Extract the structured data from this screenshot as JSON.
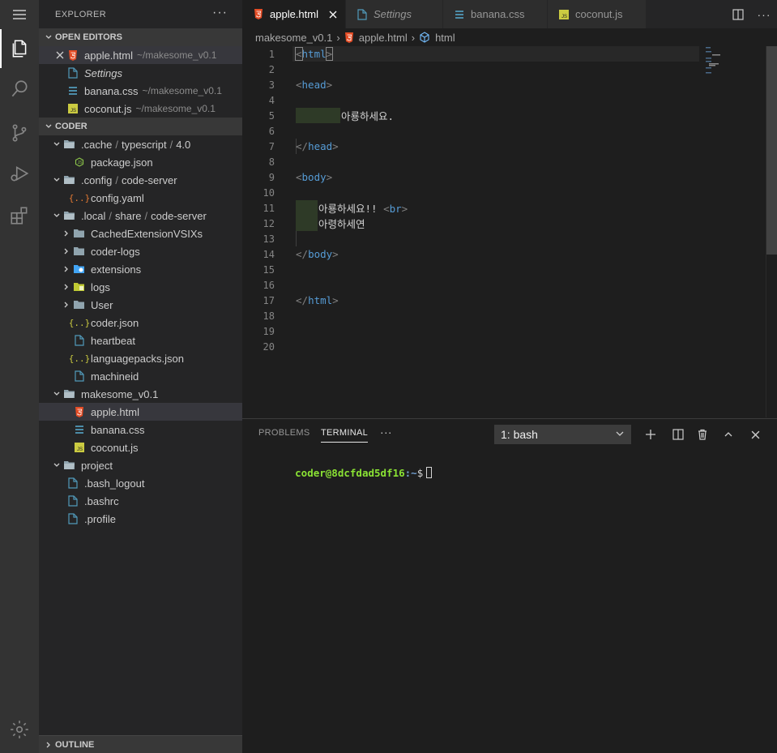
{
  "activity_bar": {
    "items": [
      "explorer-icon",
      "search-icon",
      "source-control-icon",
      "run-debug-icon",
      "extensions-icon"
    ],
    "bottom": "settings-gear-icon"
  },
  "sidebar": {
    "title": "EXPLORER",
    "more": "···",
    "open_editors": {
      "header": "OPEN EDITORS",
      "items": [
        {
          "name": "apple.html",
          "desc": "~/makesome_v0.1"
        },
        {
          "name": "Settings",
          "desc": ""
        },
        {
          "name": "banana.css",
          "desc": "~/makesome_v0.1"
        },
        {
          "name": "coconut.js",
          "desc": "~/makesome_v0.1"
        }
      ]
    },
    "workspace": {
      "header": "CODER",
      "cache": {
        "parts": [
          ".cache",
          "typescript",
          "4.0"
        ]
      },
      "package_json": "package.json",
      "config": {
        "parts": [
          ".config",
          "code-server"
        ]
      },
      "config_yaml": "config.yaml",
      "local": {
        "parts": [
          ".local",
          "share",
          "code-server"
        ]
      },
      "folders": [
        "CachedExtensionVSIXs",
        "coder-logs",
        "extensions",
        "logs",
        "User"
      ],
      "files": [
        "coder.json",
        "heartbeat",
        "languagepacks.json",
        "machineid"
      ],
      "makesome": "makesome_v0.1",
      "makesome_files": [
        "apple.html",
        "banana.css",
        "coconut.js"
      ],
      "project": "project",
      "project_files": [
        ".bash_logout",
        ".bashrc",
        ".profile"
      ]
    },
    "outline": "OUTLINE"
  },
  "tabs": [
    {
      "label": "apple.html",
      "active": true
    },
    {
      "label": "Settings",
      "active": false
    },
    {
      "label": "banana.css",
      "active": false
    },
    {
      "label": "coconut.js",
      "active": false
    }
  ],
  "breadcrumb": {
    "folder": "makesome_v0.1",
    "file": "apple.html",
    "symbol": "html"
  },
  "code": {
    "lines": [
      "1",
      "2",
      "3",
      "4",
      "5",
      "6",
      "7",
      "8",
      "9",
      "10",
      "11",
      "12",
      "13",
      "14",
      "15",
      "16",
      "17",
      "18",
      "19",
      "20"
    ],
    "html_open": "html",
    "head_open": "head",
    "line5_text": "아룡하세요.",
    "head_close": "head",
    "body_open": "body",
    "line11_text": "아룡하세요!! ",
    "br": "br",
    "line12_text": "아령하세연",
    "body_close": "body",
    "html_close": "html"
  },
  "panel": {
    "tabs": [
      "PROBLEMS",
      "TERMINAL"
    ],
    "more": "···",
    "terminal_select": "1: bash",
    "prompt_user": "coder@8dcfdad5df16",
    "prompt_path": ":~",
    "prompt_dollar": "$"
  },
  "colors": {
    "html_icon": "#e44d26",
    "css_icon": "#519aba",
    "js_icon": "#cbcb41",
    "json_icon": "#cbcb41",
    "yaml_icon": "#e37933",
    "folder": "#90a4ae",
    "doc_icon": "#519aba"
  }
}
